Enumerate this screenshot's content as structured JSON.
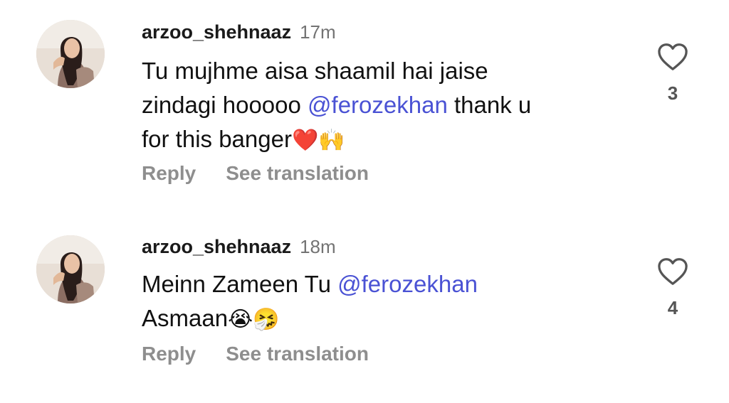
{
  "comments": [
    {
      "username": "arzoo_shehnaaz",
      "time": "17m",
      "line1": "Tu mujhme aisa shaamil hai jaise",
      "line2_pre": "zindagi hooooo ",
      "line2_mention": "@ferozekhan",
      "line2_post": " thank u",
      "line3": "for this banger",
      "line3_emoji": "❤️🙌",
      "reply": "Reply",
      "translate": "See translation",
      "likes": "3",
      "like_icon": "heart-outline-icon"
    },
    {
      "username": "arzoo_shehnaaz",
      "time": "18m",
      "line1_pre": "Meinn Zameen Tu ",
      "line1_mention": "@ferozekhan",
      "line2": "Asmaan",
      "line2_emoji": "😭🤧",
      "reply": "Reply",
      "translate": "See translation",
      "likes": "4",
      "like_icon": "heart-outline-icon"
    }
  ],
  "colors": {
    "mention": "#4a52d4",
    "secondary_text": "#8e8e8e",
    "username": "#1a1a1a"
  }
}
